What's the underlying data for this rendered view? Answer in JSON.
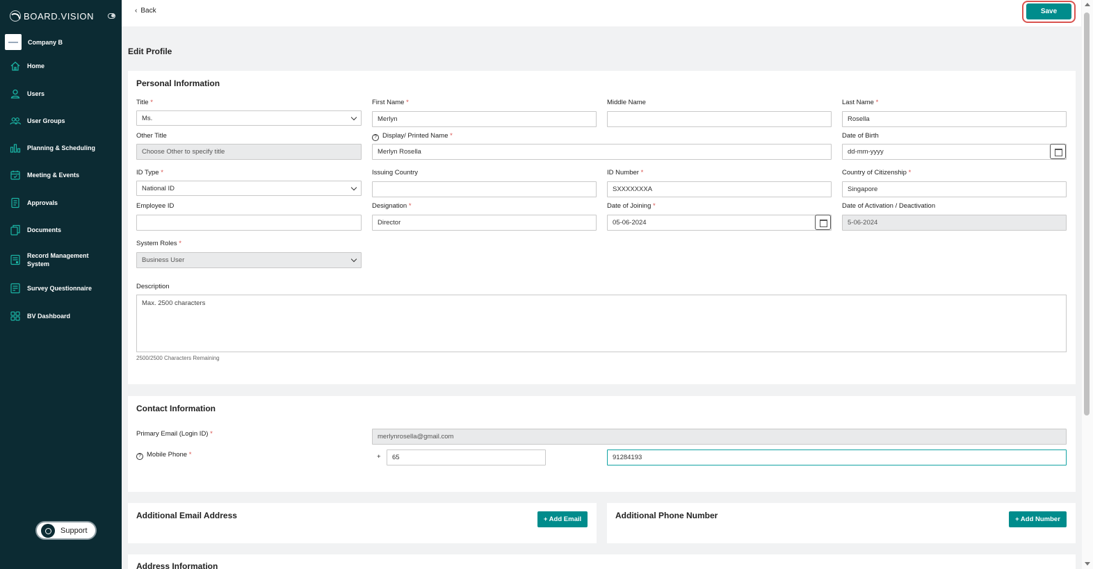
{
  "brand": {
    "name": "BOARD.VISION"
  },
  "company": {
    "name": "Company B"
  },
  "nav": {
    "items": [
      {
        "label": "Home",
        "icon": "home-icon"
      },
      {
        "label": "Users",
        "icon": "user-icon"
      },
      {
        "label": "User Groups",
        "icon": "users-icon"
      },
      {
        "label": "Planning & Scheduling",
        "icon": "chart-icon"
      },
      {
        "label": "Meeting & Events",
        "icon": "calendar-icon"
      },
      {
        "label": "Approvals",
        "icon": "document-icon"
      },
      {
        "label": "Documents",
        "icon": "documents-icon"
      },
      {
        "label": "Record Management",
        "label2": "System",
        "icon": "record-icon"
      },
      {
        "label": "Survey Questionnaire",
        "icon": "survey-icon"
      },
      {
        "label": "BV Dashboard",
        "icon": "dashboard-icon"
      }
    ],
    "support_label": "Support"
  },
  "toolbar": {
    "back_label": "Back",
    "save_label": "Save"
  },
  "page": {
    "title": "Edit Profile"
  },
  "personal": {
    "section_title": "Personal Information",
    "title_label": "Title",
    "title_value": "Ms.",
    "first_name_label": "First Name",
    "first_name_value": "Merlyn",
    "middle_name_label": "Middle Name",
    "middle_name_value": "",
    "last_name_label": "Last Name",
    "last_name_value": "Rosella",
    "other_title_label": "Other Title",
    "other_title_placeholder": "Choose Other to specify title",
    "display_name_label": "Display/ Printed Name",
    "display_name_value": "Merlyn Rosella",
    "dob_label": "Date of Birth",
    "dob_placeholder": "dd-mm-yyyy",
    "id_type_label": "ID Type",
    "id_type_value": "National ID",
    "issuing_country_label": "Issuing Country",
    "issuing_country_value": "",
    "id_number_label": "ID Number",
    "id_number_value": "SXXXXXXXA",
    "citizenship_label": "Country of Citizenship",
    "citizenship_value": "Singapore",
    "employee_id_label": "Employee ID",
    "employee_id_value": "",
    "designation_label": "Designation",
    "designation_value": "Director",
    "doj_label": "Date of Joining",
    "doj_value": "05-06-2024",
    "activation_label": "Date of Activation / Deactivation",
    "activation_value": "5-06-2024",
    "system_roles_label": "System Roles",
    "system_roles_value": "Business User",
    "description_label": "Description",
    "description_placeholder": "Max. 2500 characters",
    "chars_remaining": "2500/2500 Characters Remaining",
    "required_mark": "*"
  },
  "contact": {
    "section_title": "Contact Information",
    "primary_email_label": "Primary Email (Login ID)",
    "primary_email_value": "merlynrosella@gmail.com",
    "mobile_label": "Mobile Phone",
    "plus": "+",
    "country_code": "65",
    "mobile_value": "91284193"
  },
  "additional_email": {
    "section_title": "Additional Email Address",
    "button_label": "+ Add Email"
  },
  "additional_phone": {
    "section_title": "Additional Phone Number",
    "button_label": "+ Add Number"
  },
  "address": {
    "section_title": "Address Information"
  },
  "colors": {
    "sidebar": "#0c2b33",
    "accent": "#008c8c",
    "required": "#d9534f"
  }
}
